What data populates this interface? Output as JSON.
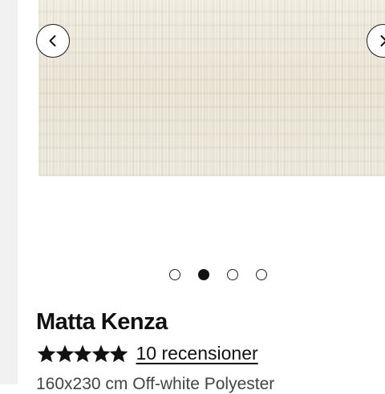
{
  "product": {
    "title": "Matta Kenza",
    "rating_stars": 5,
    "reviews_label": "10 recensioner",
    "subtitle": "160x230 cm Off-white Polyester"
  },
  "carousel": {
    "slide_count": 4,
    "active_index": 1,
    "prev_icon": "chevron-left-icon",
    "next_icon": "chevron-right-icon"
  },
  "colors": {
    "text": "#111111",
    "star": "#111111",
    "image_base": "#ece8d9"
  }
}
